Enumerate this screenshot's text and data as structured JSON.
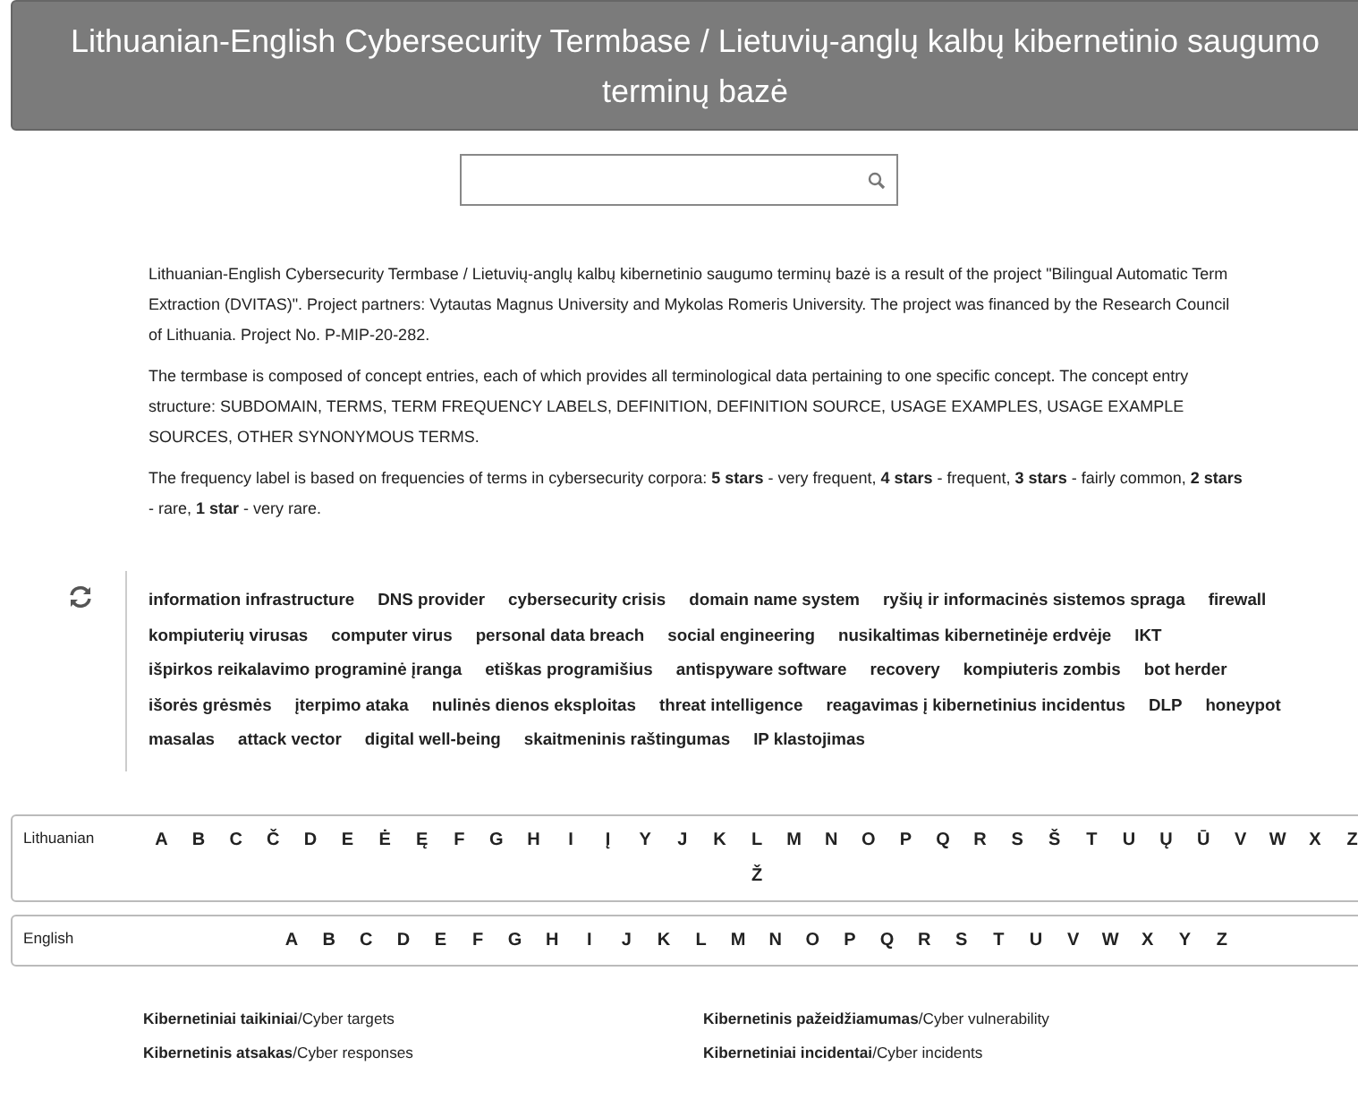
{
  "header": {
    "title": "Lithuanian-English Cybersecurity Termbase / Lietuvių-anglų kalbų kibernetinio saugumo terminų bazė"
  },
  "intro": [
    "Lithuanian-English Cybersecurity Termbase / Lietuvių-anglų kalbų kibernetinio saugumo terminų bazė is a result of the project \"Bilingual Automatic Term Extraction (DVITAS)\". Project partners: Vytautas Magnus University and Mykolas Romeris University. The project was financed by the Research Council of Lithuania. Project No. P-MIP-20-282.",
    "The termbase is composed of concept entries, each of which provides all terminological data pertaining to one specific concept. The concept entry structure: SUBDOMAIN, TERMS, TERM FREQUENCY LABELS, DEFINITION, DEFINITION SOURCE, USAGE EXAMPLES, USAGE EXAMPLE SOURCES, OTHER SYNONYMOUS TERMS.",
    "The frequency label is based on frequencies of terms in cybersecurity corpora: **5 stars** - very frequent, **4 stars** - frequent, **3 stars** - fairly common, **2 stars** - rare, **1 star** - very rare."
  ],
  "term_cloud": [
    "information infrastructure",
    "DNS provider",
    "cybersecurity crisis",
    "domain name system",
    "ryšių ir informacinės sistemos spraga",
    "firewall",
    "kompiuterių virusas",
    "computer virus",
    "personal data breach",
    "social engineering",
    "nusikaltimas kibernetinėje erdvėje",
    "IKT",
    "išpirkos reikalavimo programinė įranga",
    "etiškas programišius",
    "antispyware software",
    "recovery",
    "kompiuteris zombis",
    "bot herder",
    "išorės grėsmės",
    "įterpimo ataka",
    "nulinės dienos eksploitas",
    "threat intelligence",
    "reagavimas į kibernetinius incidentus",
    "DLP",
    "honeypot",
    "masalas",
    "attack vector",
    "digital well-being",
    "skaitmeninis raštingumas",
    "IP klastojimas"
  ],
  "alphabets": [
    {
      "label": "Lithuanian",
      "letters": [
        "A",
        "B",
        "C",
        "Č",
        "D",
        "E",
        "Ė",
        "Ę",
        "F",
        "G",
        "H",
        "I",
        "Į",
        "Y",
        "J",
        "K",
        "L",
        "M",
        "N",
        "O",
        "P",
        "Q",
        "R",
        "S",
        "Š",
        "T",
        "U",
        "Ų",
        "Ū",
        "V",
        "W",
        "X",
        "Z",
        "Ž"
      ]
    },
    {
      "label": "English",
      "letters": [
        "A",
        "B",
        "C",
        "D",
        "E",
        "F",
        "G",
        "H",
        "I",
        "J",
        "K",
        "L",
        "M",
        "N",
        "O",
        "P",
        "Q",
        "R",
        "S",
        "T",
        "U",
        "V",
        "W",
        "X",
        "Y",
        "Z"
      ]
    }
  ],
  "subdomains": [
    "**Kibernetiniai taikiniai**/Cyber targets",
    "**Kibernetinis pažeidžiamumas**/Cyber vulnerability",
    "**Kibernetinis atsakas**/Cyber responses",
    "**Kibernetiniai incidentai**/Cyber incidents"
  ]
}
